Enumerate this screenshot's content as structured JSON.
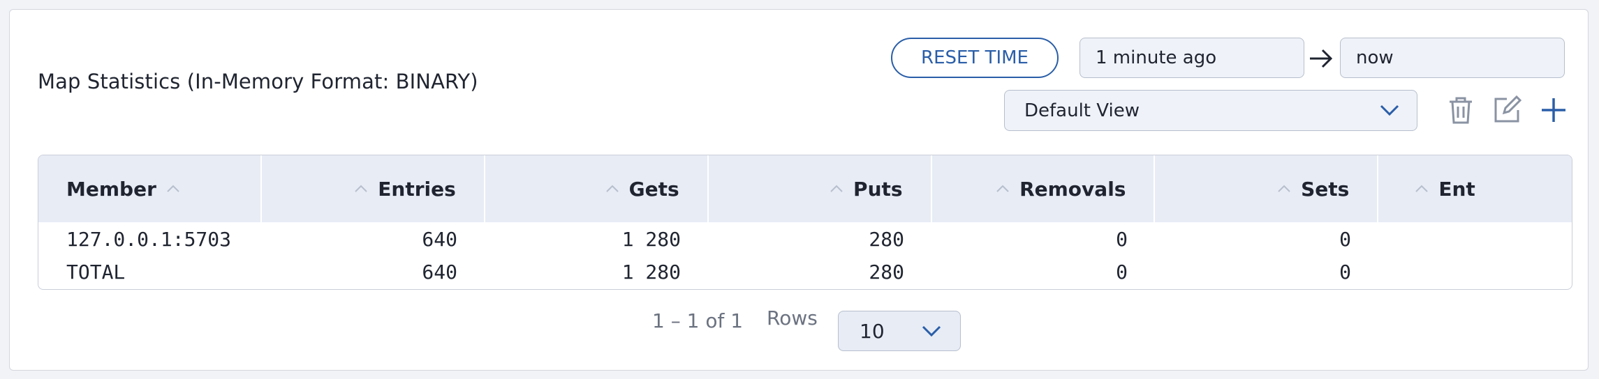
{
  "header": {
    "title": "Map Statistics (In-Memory Format: BINARY)",
    "reset_label": "RESET TIME",
    "time_from": "1 minute ago",
    "time_to": "now",
    "view_selected": "Default View"
  },
  "table": {
    "columns": [
      "Member",
      "Entries",
      "Gets",
      "Puts",
      "Removals",
      "Sets",
      "Ent"
    ],
    "rows": [
      [
        "127.0.0.1:5703",
        "640",
        "1 280",
        "280",
        "0",
        "0",
        ""
      ],
      [
        "TOTAL",
        "640",
        "1 280",
        "280",
        "0",
        "0",
        ""
      ]
    ]
  },
  "pagination": {
    "range": "1 – 1 of 1",
    "rows_label": "Rows",
    "rows_value": "10"
  },
  "colors": {
    "accent": "#2a5ea8",
    "header_bg": "#e7ecf5",
    "text": "#1f2430"
  },
  "icons": [
    "arrow-right-icon",
    "chevron-down-icon",
    "trash-icon",
    "edit-icon",
    "plus-icon",
    "sort-up-icon"
  ]
}
